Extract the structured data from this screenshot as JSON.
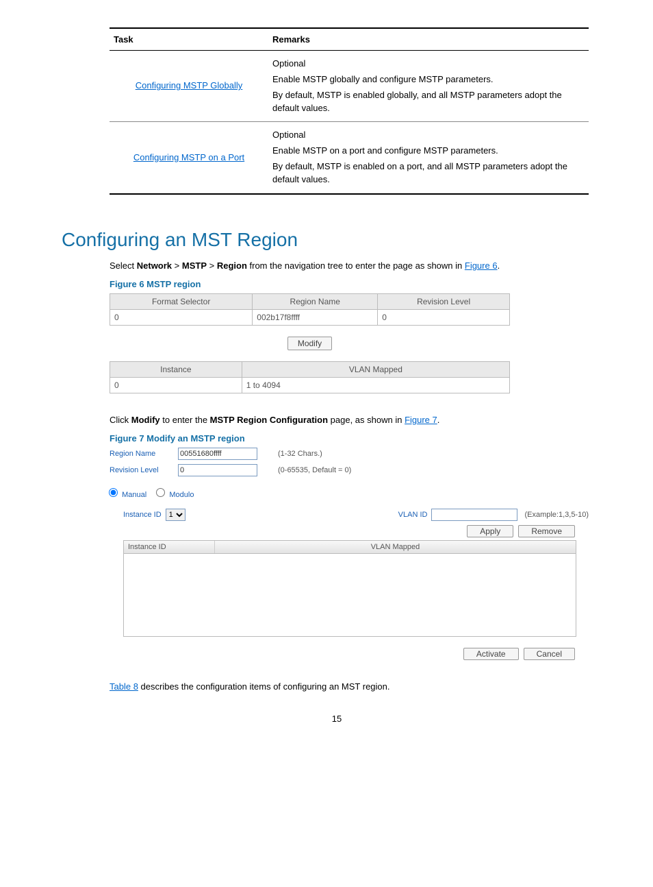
{
  "tasks_table": {
    "headers": [
      "Task",
      "Remarks"
    ],
    "rows": [
      {
        "task_link": "Configuring MSTP Globally",
        "remarks": [
          "Optional",
          "Enable MSTP globally and configure MSTP parameters.",
          "By default, MSTP is enabled globally, and all MSTP parameters adopt the default values."
        ]
      },
      {
        "task_link": "Configuring MSTP on a Port",
        "remarks": [
          "Optional",
          "Enable MSTP on a port and configure MSTP parameters.",
          "By default, MSTP is enabled on a port, and all MSTP parameters adopt the default values."
        ]
      }
    ]
  },
  "heading": "Configuring an MST Region",
  "intro": {
    "pre": "Select ",
    "b1": "Network",
    "sep1": " > ",
    "b2": "MSTP",
    "sep2": " > ",
    "b3": "Region",
    "post": " from the navigation tree to enter the page as shown in ",
    "link": "Figure 6",
    "end": "."
  },
  "fig6": {
    "caption": "Figure 6 MSTP region",
    "t1_headers": [
      "Format Selector",
      "Region Name",
      "Revision Level"
    ],
    "t1_row": [
      "0",
      "002b17f8ffff",
      "0"
    ],
    "modify_btn": "Modify",
    "t2_headers": [
      "Instance",
      "VLAN Mapped"
    ],
    "t2_row": [
      "0",
      "1 to 4094"
    ]
  },
  "mid_para": {
    "pre": "Click ",
    "b1": "Modify",
    "mid": " to enter the ",
    "b2": "MSTP Region Configuration",
    "post": " page, as shown in ",
    "link": "Figure 7",
    "end": "."
  },
  "fig7": {
    "caption": "Figure 7 Modify an MSTP region",
    "region_name_label": "Region Name",
    "region_name_value": "00551680ffff",
    "region_name_hint": "(1-32 Chars.)",
    "revision_label": "Revision Level",
    "revision_value": "0",
    "revision_hint": "(0-65535, Default = 0)",
    "radio1": "Manual",
    "radio2": "Modulo",
    "instance_id_label": "Instance ID",
    "instance_id_value": "1",
    "vlan_id_label": "VLAN ID",
    "vlan_id_hint": "(Example:1,3,5-10)",
    "apply_btn": "Apply",
    "remove_btn": "Remove",
    "map_headers": [
      "Instance ID",
      "VLAN Mapped"
    ],
    "activate_btn": "Activate",
    "cancel_btn": "Cancel"
  },
  "tail": {
    "link": "Table 8",
    "text": " describes the configuration items of configuring an MST region."
  },
  "page_number": "15"
}
